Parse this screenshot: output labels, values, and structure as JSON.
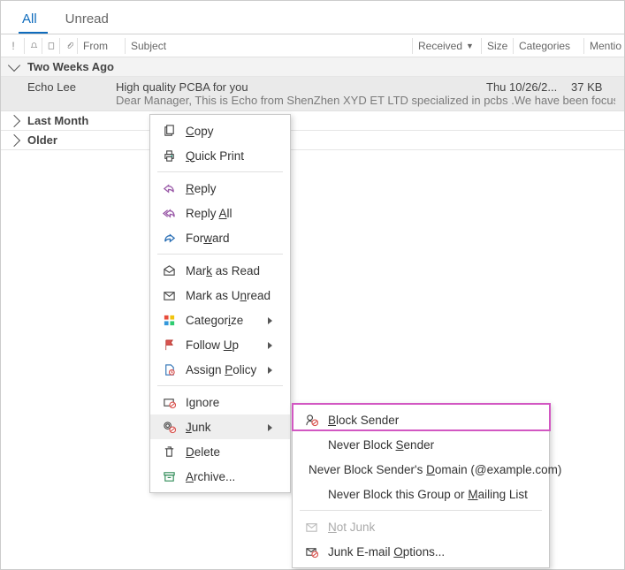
{
  "tabs": {
    "all": "All",
    "unread": "Unread"
  },
  "headers": {
    "from": "From",
    "subject": "Subject",
    "received": "Received",
    "size": "Size",
    "categories": "Categories",
    "mentions": "Mentio"
  },
  "groups": {
    "two_weeks": "Two Weeks Ago",
    "last_month": "Last Month",
    "older": "Older"
  },
  "message": {
    "from": "Echo Lee",
    "subject": "High quality PCBA for you",
    "received": "Thu 10/26/2...",
    "size": "37 KB",
    "preview": "Dear Manager,  This is Echo from ShenZhen XYD ET LTD specialized in pcbs .We have been focusing on this field for se"
  },
  "menu1": {
    "copy": "Copy",
    "quick_print": "Quick Print",
    "reply": "Reply",
    "reply_all": "Reply All",
    "forward": "Forward",
    "mark_read": "Mark as Read",
    "mark_unread": "Mark as Unread",
    "categorize": "Categorize",
    "follow_up": "Follow Up",
    "assign_policy": "Assign Policy",
    "ignore": "Ignore",
    "junk": "Junk",
    "delete": "Delete",
    "archive": "Archive..."
  },
  "menu2": {
    "block_sender": "Block Sender",
    "never_block_sender": "Never Block Sender",
    "never_block_domain": "Never Block Sender's Domain (@example.com)",
    "never_block_group": "Never Block this Group or Mailing List",
    "not_junk": "Not Junk",
    "junk_options": "Junk E-mail Options..."
  }
}
